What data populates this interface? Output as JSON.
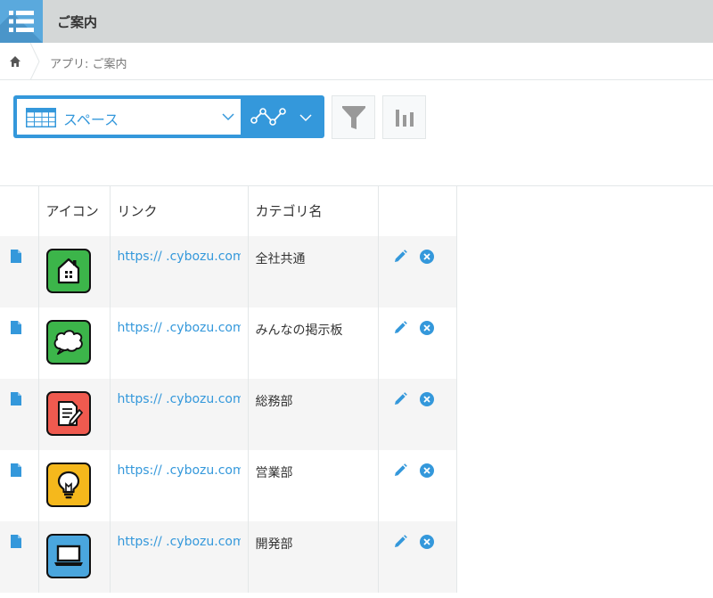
{
  "header": {
    "title": "ご案内"
  },
  "breadcrumb": {
    "text": "アプリ: ご案内"
  },
  "view": {
    "selected": "スペース"
  },
  "table": {
    "columns": [
      "",
      "アイコン",
      "リンク",
      "カテゴリ名",
      ""
    ],
    "rows": [
      {
        "link": "https://        .cybozu.com/k/",
        "category": "全社共通",
        "icon": "house-icon",
        "color": "#3cb54a"
      },
      {
        "link": "https://        .cybozu.com/k/",
        "category": "みんなの掲示板",
        "icon": "speech-bubble-icon",
        "color": "#3cb54a"
      },
      {
        "link": "https://        .cybozu.com/k/",
        "category": "総務部",
        "icon": "document-pen-icon",
        "color": "#ef5a4f"
      },
      {
        "link": "https://        .cybozu.com/k/",
        "category": "営業部",
        "icon": "lightbulb-icon",
        "color": "#f5b81c"
      },
      {
        "link": "https://        .cybozu.com/k/",
        "category": "開発部",
        "icon": "laptop-icon",
        "color": "#4aa6de"
      }
    ]
  },
  "colors": {
    "accent": "#3498db",
    "header_bg": "#d4d7d7"
  }
}
